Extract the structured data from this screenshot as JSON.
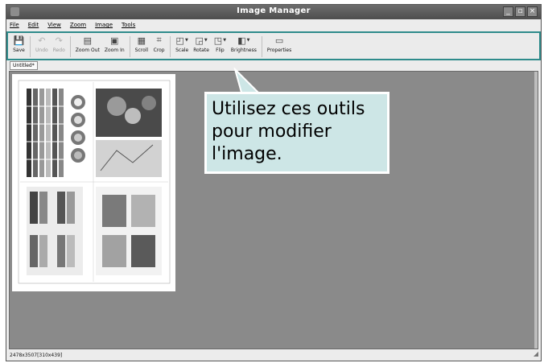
{
  "window": {
    "title": "Image Manager",
    "controls": [
      "_",
      "▫",
      "×"
    ]
  },
  "menubar": [
    "File",
    "Edit",
    "View",
    "Zoom",
    "Image",
    "Tools"
  ],
  "toolbar": {
    "save": "Save",
    "undo": "Undo",
    "redo": "Redo",
    "zoom_out": "Zoom Out",
    "zoom_in": "Zoom In",
    "scroll": "Scroll",
    "crop": "Crop",
    "scale": "Scale",
    "rotate": "Rotate",
    "flip": "Flip",
    "brightness": "Brightness",
    "properties": "Properties"
  },
  "tabs": [
    {
      "label": "Untitled*"
    }
  ],
  "statusbar": {
    "dimensions": "2478x3507[310x439]"
  },
  "callout": {
    "lines": [
      "Utilisez ces outils",
      "pour modifier",
      "l'image."
    ]
  },
  "colors": {
    "titlebar": "#5a5a5a",
    "highlight_border": "#2e8b8b",
    "callout_bg": "#cde6e6",
    "canvas_bg": "#8a8a8a"
  }
}
